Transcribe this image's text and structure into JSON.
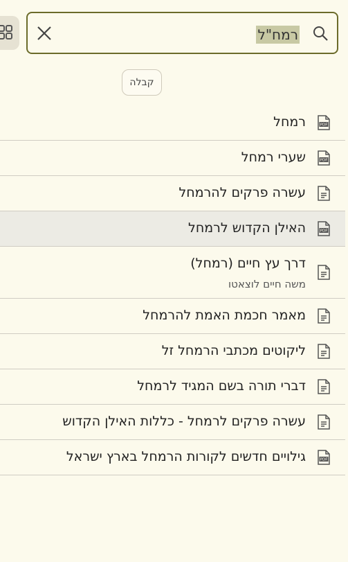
{
  "search": {
    "query": "רמח\"ל"
  },
  "filter_chip": {
    "label": "קבלה"
  },
  "results": [
    {
      "title": "רמחל",
      "icon": "pdf-file-icon"
    },
    {
      "title": "שערי רמחל",
      "icon": "pdf-file-icon"
    },
    {
      "title": "עשרה פרקים להרמחל",
      "icon": "text-file-icon"
    },
    {
      "title": "האילן הקדוש לרמחל",
      "icon": "pdf-file-icon",
      "highlighted": true
    },
    {
      "title": "דרך עץ חיים (רמחל)",
      "subtitle": "משה חיים לוצאטו",
      "icon": "text-file-icon"
    },
    {
      "title": "מאמר חכמת האמת להרמחל",
      "icon": "text-file-icon"
    },
    {
      "title": "ליקוטים מכתבי הרמחל זל",
      "icon": "text-file-icon"
    },
    {
      "title": "דברי תורה בשם המגיד לרמחל",
      "icon": "text-file-icon"
    },
    {
      "title": "עשרה פרקים לרמחל - כללות האילן הקדוש",
      "icon": "text-file-icon"
    },
    {
      "title": "גילויים חדשים לקורות הרמחל בארץ ישראל",
      "icon": "pdf-file-icon"
    }
  ],
  "colors": {
    "background": "#fcfaec",
    "border": "#6b6b2a",
    "highlight": "#ecebe4",
    "selection": "#c8c9a4"
  }
}
